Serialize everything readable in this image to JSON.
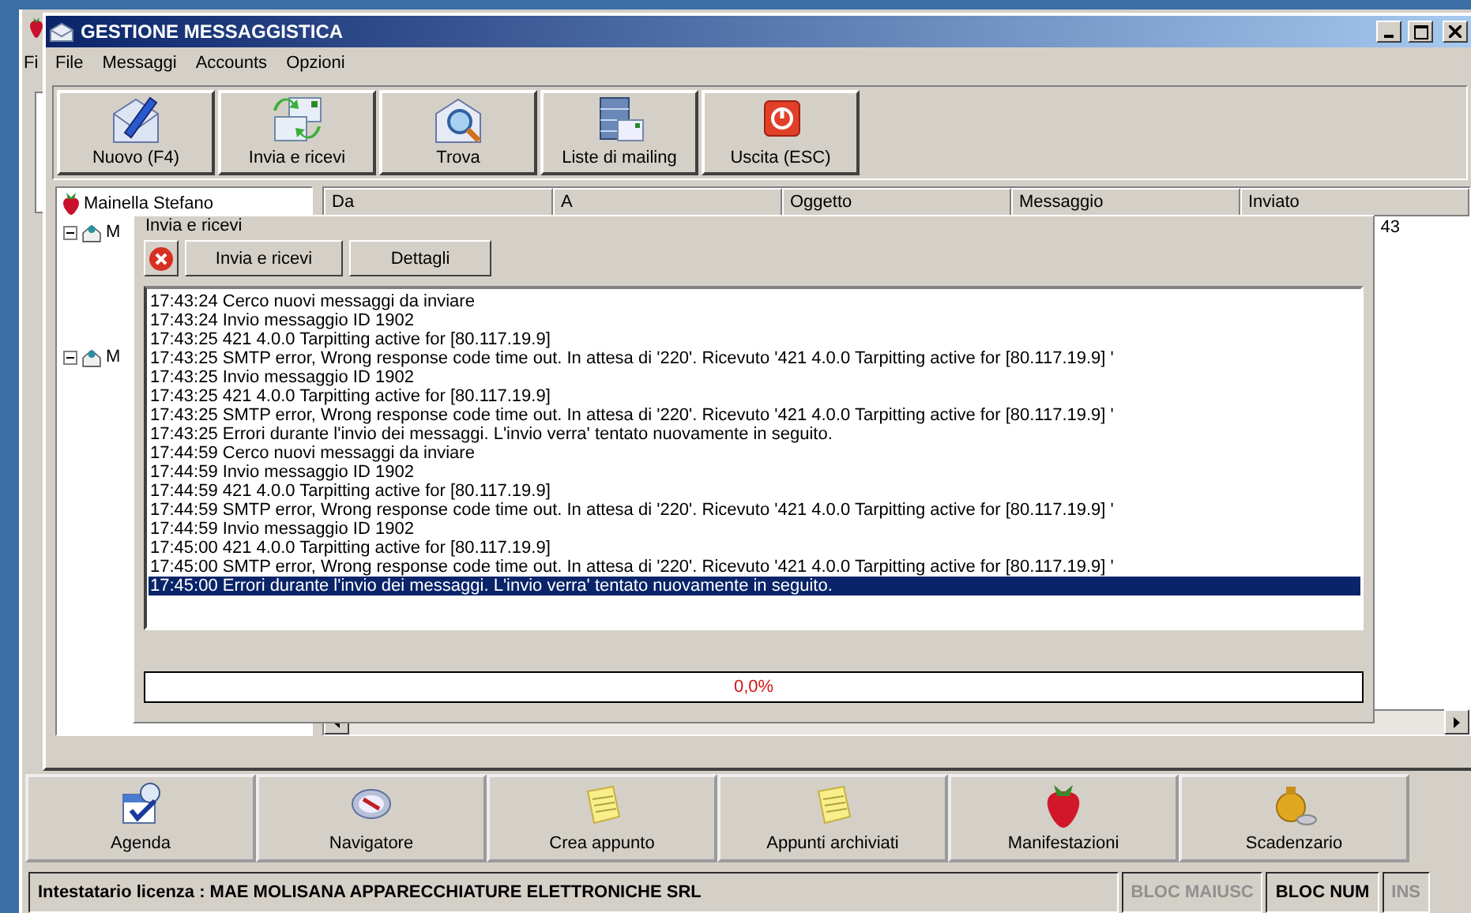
{
  "background_app": {
    "menu": [
      "Fi"
    ],
    "bottom_toolbar": [
      {
        "label": "Agenda"
      },
      {
        "label": "Navigatore"
      },
      {
        "label": "Crea appunto"
      },
      {
        "label": "Appunti archiviati"
      },
      {
        "label": "Manifestazioni"
      },
      {
        "label": "Scadenzario"
      }
    ],
    "status_bar": {
      "license": "Intestatario licenza : MAE MOLISANA APPARECCHIATURE ELETTRONICHE SRL",
      "indicators": [
        {
          "label": "BLOC MAIUSC",
          "active": false
        },
        {
          "label": "BLOC NUM",
          "active": true
        },
        {
          "label": "INS",
          "active": false
        }
      ]
    }
  },
  "window": {
    "title": "GESTIONE MESSAGGISTICA",
    "menu": [
      "File",
      "Messaggi",
      "Accounts",
      "Opzioni"
    ],
    "toolbar": [
      {
        "label": "Nuovo (F4)"
      },
      {
        "label": "Invia e ricevi"
      },
      {
        "label": "Trova"
      },
      {
        "label": "Liste di mailing"
      },
      {
        "label": "Uscita (ESC)"
      }
    ],
    "tree": {
      "label": "Mainella Stefano",
      "children": [
        {
          "label": "M",
          "expanded": true
        },
        {
          "label": "M",
          "expanded": true
        }
      ]
    },
    "table": {
      "columns": [
        "Da",
        "A",
        "Oggetto",
        "Messaggio",
        "Inviato"
      ],
      "rows": [
        {
          "inviato": "43"
        }
      ]
    }
  },
  "dialog": {
    "title": "Invia e ricevi",
    "buttons": [
      "Invia e ricevi",
      "Dettagli"
    ],
    "log": [
      {
        "text": "17:43:24 Cerco nuovi messaggi da inviare",
        "selected": false
      },
      {
        "text": "17:43:24 Invio messaggio ID 1902",
        "selected": false
      },
      {
        "text": "17:43:25 421 4.0.0 Tarpitting active for [80.117.19.9]",
        "selected": false
      },
      {
        "text": "17:43:25 SMTP error, Wrong response code time out. In attesa di '220'. Ricevuto '421 4.0.0 Tarpitting active for [80.117.19.9] '",
        "selected": false
      },
      {
        "text": "17:43:25 Invio messaggio ID 1902",
        "selected": false
      },
      {
        "text": "17:43:25 421 4.0.0 Tarpitting active for [80.117.19.9]",
        "selected": false
      },
      {
        "text": "17:43:25 SMTP error, Wrong response code time out. In attesa di '220'. Ricevuto '421 4.0.0 Tarpitting active for [80.117.19.9] '",
        "selected": false
      },
      {
        "text": "17:43:25 Errori durante l'invio dei messaggi. L'invio verra' tentato nuovamente in seguito.",
        "selected": false
      },
      {
        "text": "17:44:59 Cerco nuovi messaggi da inviare",
        "selected": false
      },
      {
        "text": "17:44:59 Invio messaggio ID 1902",
        "selected": false
      },
      {
        "text": "17:44:59 421 4.0.0 Tarpitting active for [80.117.19.9]",
        "selected": false
      },
      {
        "text": "17:44:59 SMTP error, Wrong response code time out. In attesa di '220'. Ricevuto '421 4.0.0 Tarpitting active for [80.117.19.9] '",
        "selected": false
      },
      {
        "text": "17:44:59 Invio messaggio ID 1902",
        "selected": false
      },
      {
        "text": "17:45:00 421 4.0.0 Tarpitting active for [80.117.19.9]",
        "selected": false
      },
      {
        "text": "17:45:00 SMTP error, Wrong response code time out. In attesa di '220'. Ricevuto '421 4.0.0 Tarpitting active for [80.117.19.9] '",
        "selected": false
      },
      {
        "text": "17:45:00 Errori durante l'invio dei messaggi. L'invio verra' tentato nuovamente in seguito.",
        "selected": true
      }
    ],
    "progress": {
      "level": 0,
      "reading": "0,0%"
    }
  }
}
